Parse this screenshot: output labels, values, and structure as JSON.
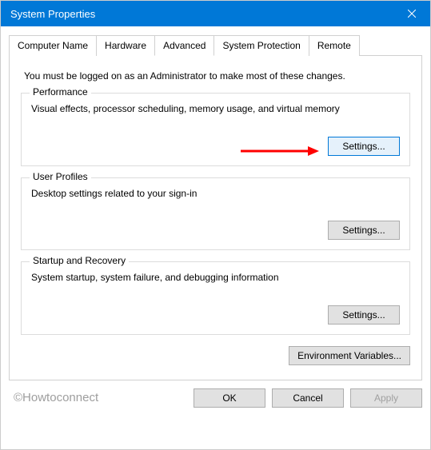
{
  "titlebar": {
    "title": "System Properties"
  },
  "tabs": [
    {
      "label": "Computer Name"
    },
    {
      "label": "Hardware"
    },
    {
      "label": "Advanced"
    },
    {
      "label": "System Protection"
    },
    {
      "label": "Remote"
    }
  ],
  "intro": "You must be logged on as an Administrator to make most of these changes.",
  "groups": {
    "performance": {
      "title": "Performance",
      "desc": "Visual effects, processor scheduling, memory usage, and virtual memory",
      "button": "Settings..."
    },
    "userprofiles": {
      "title": "User Profiles",
      "desc": "Desktop settings related to your sign-in",
      "button": "Settings..."
    },
    "startup": {
      "title": "Startup and Recovery",
      "desc": "System startup, system failure, and debugging information",
      "button": "Settings..."
    }
  },
  "envbutton": "Environment Variables...",
  "footer": {
    "ok": "OK",
    "cancel": "Cancel",
    "apply": "Apply"
  },
  "watermark": "©Howtoconnect"
}
